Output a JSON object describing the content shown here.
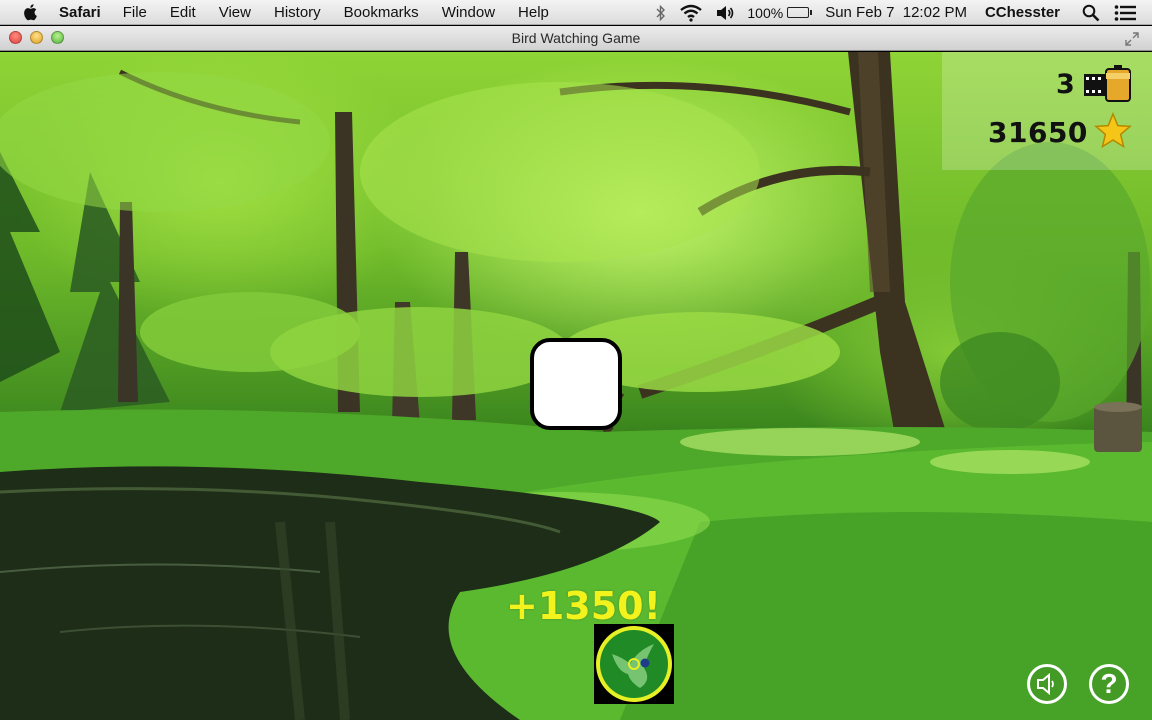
{
  "menubar": {
    "app_name": "Safari",
    "items": [
      "File",
      "Edit",
      "View",
      "History",
      "Bookmarks",
      "Window",
      "Help"
    ],
    "battery": "100%",
    "datetime": "Sun Feb 7  12:02 PM",
    "user": "CChesster",
    "icons": [
      "apple-icon",
      "bluetooth-icon",
      "wifi-icon",
      "volume-icon",
      "battery-icon",
      "spotlight-search-icon",
      "notification-center-icon"
    ]
  },
  "window": {
    "title": "Bird Watching Game"
  },
  "hud": {
    "film_remaining": "3",
    "score": "31650"
  },
  "popup": {
    "points": "+1350!"
  },
  "colors": {
    "points_text": "#f2f21c",
    "star": "#f5c518",
    "badge_ring": "#e6f024",
    "badge_fill": "#1f8a26"
  }
}
